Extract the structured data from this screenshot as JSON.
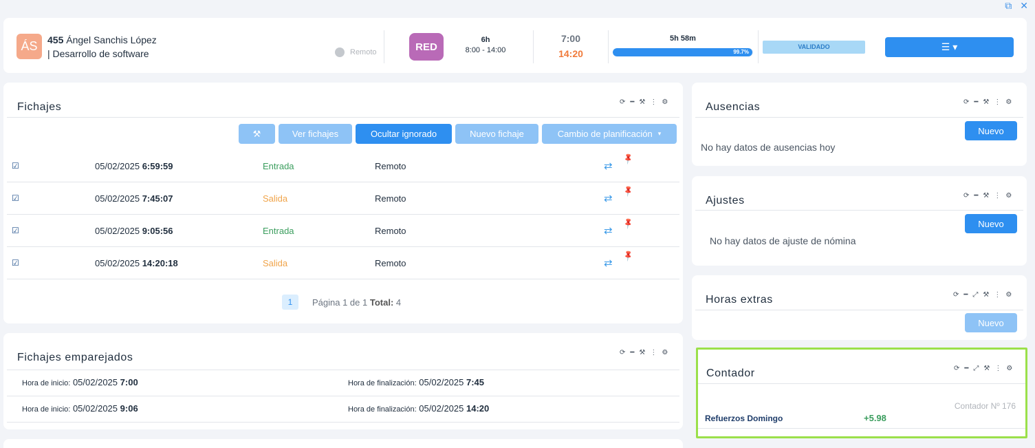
{
  "window": {
    "icons": [
      "expand-icon",
      "close-icon"
    ]
  },
  "header": {
    "initials": "ÁS",
    "employee_id": "455",
    "employee_name": "Ángel Sanchis López",
    "department": "| Desarrollo de software",
    "remote_label": "Remoto",
    "shift_code": "RED",
    "schedule_hours": "6h",
    "schedule_range": "8:00 - 14:00",
    "time_in": "7:00",
    "time_out": "14:20",
    "worked": "5h 58m",
    "progress_percent": 99.7,
    "progress_label": "99.7%",
    "status": "VALIDADO",
    "colors": {
      "accent": "#2e8ff0",
      "shift": "#b96ab7",
      "avatar": "#f5a98a",
      "time_out": "#f07a3a"
    }
  },
  "fichajes": {
    "title": "Fichajes",
    "buttons": {
      "magic": "",
      "ver": "Ver fichajes",
      "ocultar": "Ocultar ignorado",
      "nuevo": "Nuevo fichaje",
      "cambio": "Cambio de planificación"
    },
    "rows": [
      {
        "date": "05/02/2025",
        "time": "6:59:59",
        "type": "Entrada",
        "location": "Remoto"
      },
      {
        "date": "05/02/2025",
        "time": "7:45:07",
        "type": "Salida",
        "location": "Remoto"
      },
      {
        "date": "05/02/2025",
        "time": "9:05:56",
        "type": "Entrada",
        "location": "Remoto"
      },
      {
        "date": "05/02/2025",
        "time": "14:20:18",
        "type": "Salida",
        "location": "Remoto"
      }
    ],
    "pager": {
      "page": "1",
      "page_text": "Página 1 de 1",
      "total_label": "Total:",
      "total": "4"
    }
  },
  "emparejados": {
    "title": "Fichajes emparejados",
    "start_label": "Hora de inicio:",
    "end_label": "Hora de finalización:",
    "rows": [
      {
        "start_date": "05/02/2025",
        "start_time": "7:00",
        "end_date": "05/02/2025",
        "end_time": "7:45"
      },
      {
        "start_date": "05/02/2025",
        "start_time": "9:06",
        "end_date": "05/02/2025",
        "end_time": "14:20"
      }
    ]
  },
  "ausencias": {
    "title": "Ausencias",
    "button": "Nuevo",
    "empty": "No hay datos de ausencias hoy"
  },
  "ajustes": {
    "title": "Ajustes",
    "button": "Nuevo",
    "empty": "No hay datos de ajuste de nómina"
  },
  "horas_extras": {
    "title": "Horas extras",
    "button": "Nuevo"
  },
  "contador": {
    "title": "Contador",
    "number": "Contador Nº 176",
    "name": "Refuerzos Domingo",
    "value": "+5.98"
  }
}
